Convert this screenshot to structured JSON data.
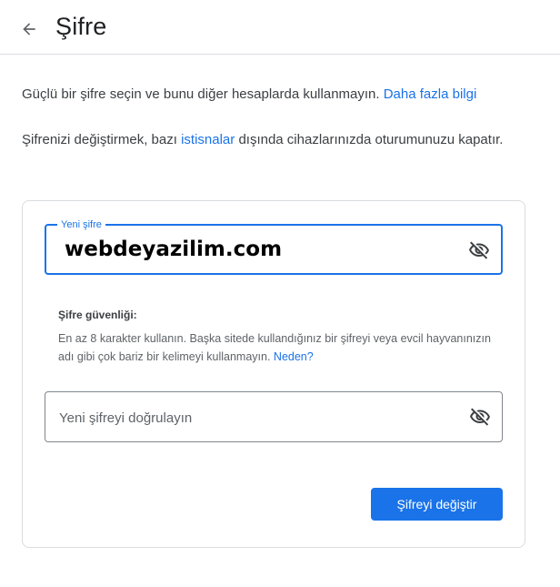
{
  "header": {
    "back_icon": "arrow-left-icon",
    "title": "Şifre"
  },
  "intro": {
    "text": "Güçlü bir şifre seçin ve bunu diğer hesaplarda kullanmayın.",
    "link": "Daha fazla bilgi"
  },
  "signout_note": {
    "before": "Şifrenizi değiştirmek, bazı",
    "link": "istisnalar",
    "after": "dışında cihazlarınızda oturumunuzu kapatır."
  },
  "new_password": {
    "label": "Yeni şifre",
    "value": "webdeyazilim.com",
    "toggle_icon": "eye-off-icon"
  },
  "strength": {
    "title": "Şifre güvenliği:",
    "description": "En az 8 karakter kullanın. Başka sitede kullandığınız bir şifreyi veya evcil hayvanınızın adı gibi çok bariz bir kelimeyi kullanmayın.",
    "link": "Neden?"
  },
  "confirm_password": {
    "placeholder": "Yeni şifreyi doğrulayın",
    "value": "",
    "toggle_icon": "eye-off-icon"
  },
  "submit": {
    "label": "Şifreyi değiştir"
  },
  "colors": {
    "accent": "#1a73e8",
    "text": "#202124",
    "secondary_text": "#5f6368",
    "border": "#dadce0"
  }
}
